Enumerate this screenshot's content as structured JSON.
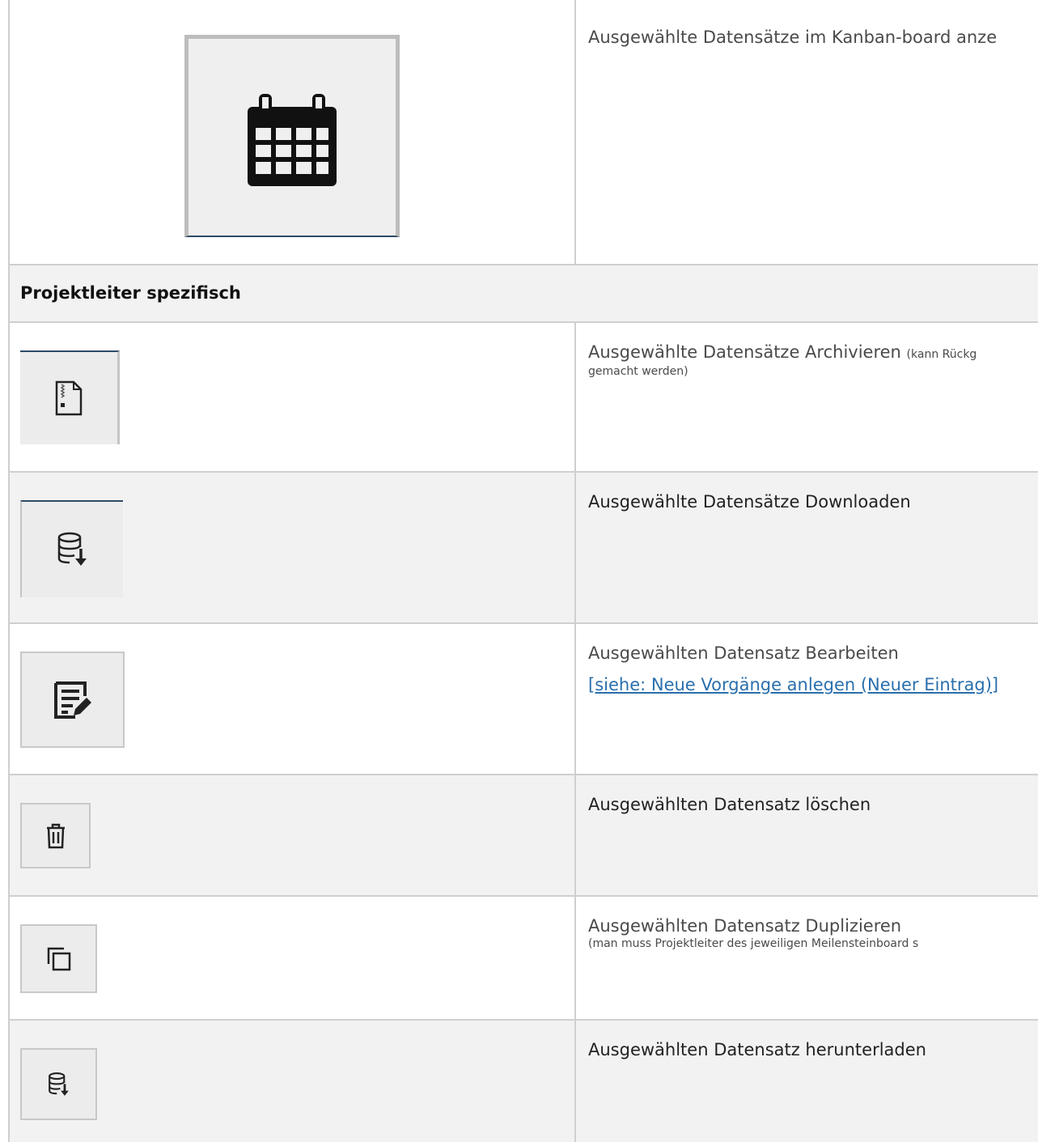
{
  "rows": [
    {
      "icon": "calendar-icon",
      "description": "Ausgewählte Datensätze im Kanban-board anze"
    },
    {
      "section_title": "Projektleiter spezifisch"
    },
    {
      "icon": "archive-zip-icon",
      "description": "Ausgewählte Datensätze Archivieren",
      "note": "(kann Rückg",
      "note_line2": "gemacht werden)"
    },
    {
      "icon": "database-download-icon",
      "description": "Ausgewählte Datensätze Downloaden"
    },
    {
      "icon": "edit-document-icon",
      "description": "Ausgewählten Datensatz Bearbeiten",
      "link": "[siehe: Neue Vorgänge anlegen (Neuer Eintrag)]"
    },
    {
      "icon": "trash-icon",
      "description": "Ausgewählten Datensatz löschen"
    },
    {
      "icon": "duplicate-icon",
      "description": "Ausgewählten Datensatz Duplizieren",
      "note": "(man muss Projektleiter des jeweiligen Meilensteinboard s"
    },
    {
      "icon": "database-download-icon",
      "description": "Ausgewählten Datensatz herunterladen"
    }
  ],
  "colors": {
    "border": "#cfcfcf",
    "row_gray": "#f2f2f2",
    "link": "#2a6fad"
  }
}
